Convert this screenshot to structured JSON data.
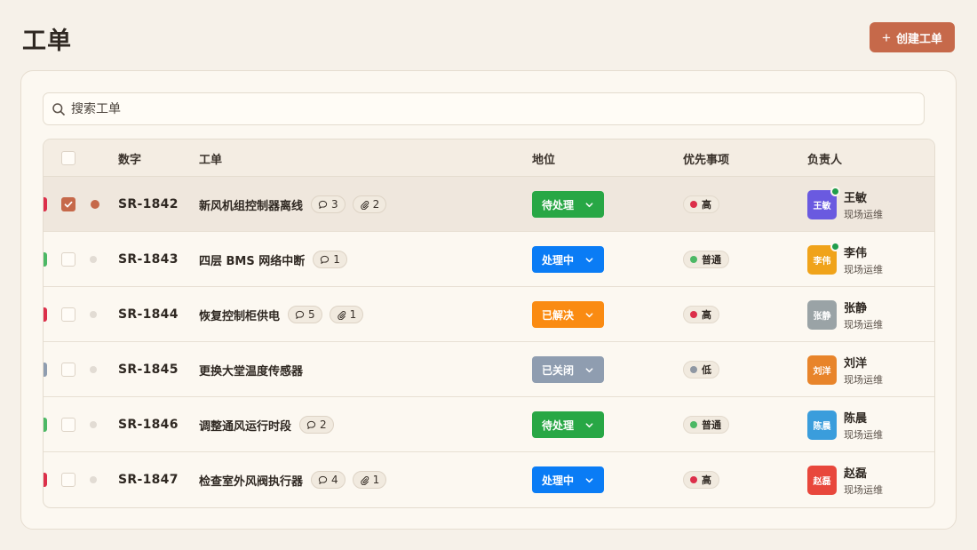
{
  "header": {
    "title": "工单",
    "create_label": "创建工单",
    "create_icon": "plus-icon",
    "accent": "#c6694a"
  },
  "search": {
    "placeholder": "搜索工单",
    "value": "",
    "icon": "search-icon"
  },
  "table": {
    "columns": [
      "",
      "数字",
      "工单",
      "地位",
      "优先事项",
      "负责人"
    ],
    "rows": [
      {
        "id": "SR-1842",
        "title": "新风机组控制器离线",
        "comments": "3",
        "attachments": "2",
        "status": "待处理",
        "status_color": "#28a745",
        "priority": "高",
        "priority_color": "#dc2f4a",
        "edge_color": "#dc2f4a",
        "assignee": "王敏",
        "avatar_text": "王敏",
        "avatar_color": "#6a5ae0",
        "role": "现场运维",
        "online": true,
        "selected": true
      },
      {
        "id": "SR-1843",
        "title": "四层 BMS 网络中断",
        "comments": "1",
        "attachments": null,
        "status": "处理中",
        "status_color": "#0a7cf5",
        "priority": "普通",
        "priority_color": "#4cb865",
        "edge_color": "#4cb865",
        "assignee": "李伟",
        "avatar_text": "李伟",
        "avatar_color": "#f0a31a",
        "role": "现场运维",
        "online": true,
        "selected": false
      },
      {
        "id": "SR-1844",
        "title": "恢复控制柜供电",
        "comments": "5",
        "attachments": "1",
        "status": "已解决",
        "status_color": "#fa8b12",
        "priority": "高",
        "priority_color": "#dc2f4a",
        "edge_color": "#dc2f4a",
        "assignee": "张静",
        "avatar_text": "张静",
        "avatar_color": "#9aa3a6",
        "role": "现场运维",
        "online": false,
        "selected": false
      },
      {
        "id": "SR-1845",
        "title": "更换大堂温度传感器",
        "comments": null,
        "attachments": null,
        "status": "已关闭",
        "status_color": "#8f9db0",
        "priority": "低",
        "priority_color": "#8f97a3",
        "edge_color": "#8f9db0",
        "assignee": "刘洋",
        "avatar_text": "刘洋",
        "avatar_color": "#e8842a",
        "role": "现场运维",
        "online": false,
        "selected": false
      },
      {
        "id": "SR-1846",
        "title": "调整通风运行时段",
        "comments": "2",
        "attachments": null,
        "status": "待处理",
        "status_color": "#28a745",
        "priority": "普通",
        "priority_color": "#4cb865",
        "edge_color": "#4cb865",
        "assignee": "陈晨",
        "avatar_text": "陈晨",
        "avatar_color": "#3a9ddc",
        "role": "现场运维",
        "online": false,
        "selected": false
      },
      {
        "id": "SR-1847",
        "title": "检查室外风阀执行器",
        "comments": "4",
        "attachments": "1",
        "status": "处理中",
        "status_color": "#0a7cf5",
        "priority": "高",
        "priority_color": "#dc2f4a",
        "edge_color": "#dc2f4a",
        "assignee": "赵磊",
        "avatar_text": "赵磊",
        "avatar_color": "#e8473c",
        "role": "现场运维",
        "online": false,
        "selected": false
      }
    ]
  }
}
